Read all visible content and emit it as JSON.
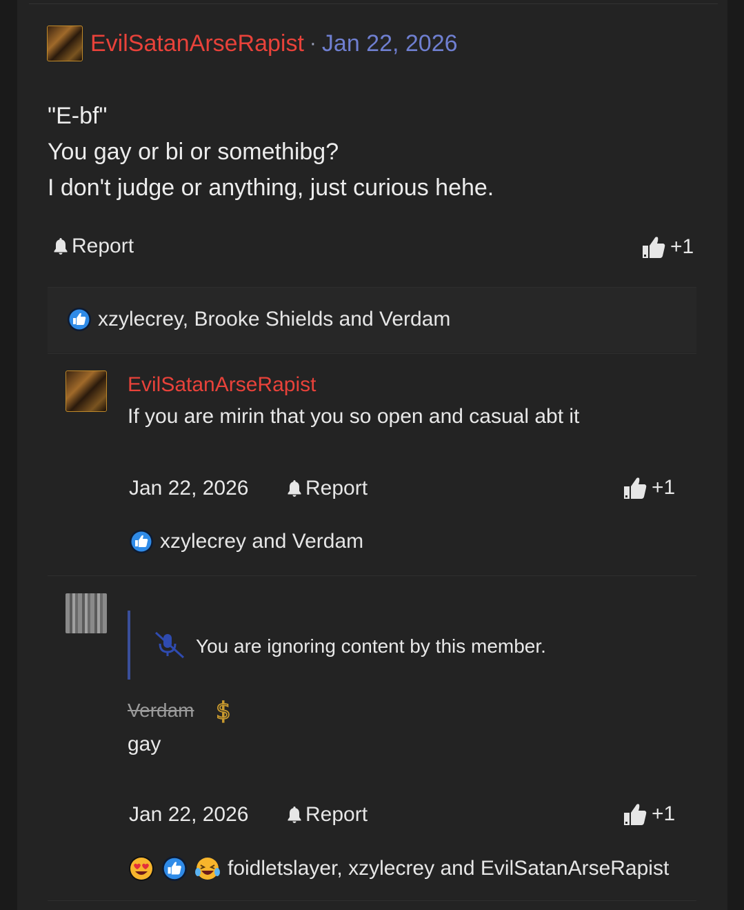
{
  "post": {
    "author": "EvilSatanArseRapist",
    "separator": "·",
    "date": "Jan 22, 2026",
    "body_lines": [
      "\"E-bf\"",
      "You gay or bi or somethibg?",
      "I don't judge or anything, just curious hehe."
    ],
    "report_label": "Report",
    "like_count": "+1",
    "reactions_text": "xzylecrey, Brooke Shields and Verdam"
  },
  "reply1": {
    "author": "EvilSatanArseRapist",
    "text": "If you are mirin that you so open and casual abt it",
    "date": "Jan 22, 2026",
    "report_label": "Report",
    "like_count": "+1",
    "reactions_text": "xzylecrey and Verdam"
  },
  "reply2": {
    "ignored_notice": "You are ignoring content by this member.",
    "author": "Verdam",
    "text": "gay",
    "date": "Jan 22, 2026",
    "report_label": "Report",
    "like_count": "+1",
    "reactions_text": "foidletslayer, xzylecrey and EvilSatanArseRapist"
  },
  "colors": {
    "username": "#e8423a",
    "date_link": "#6f7fd0",
    "like_reaction_blue": "#2f8be8",
    "ignored_bar": "#3a4f9a"
  },
  "icons": [
    "bell-icon",
    "thumbs-up-icon",
    "like-reaction-icon",
    "muted-mic-icon",
    "dollar-icon",
    "heart-eyes-emoji",
    "laughing-crying-emoji"
  ]
}
